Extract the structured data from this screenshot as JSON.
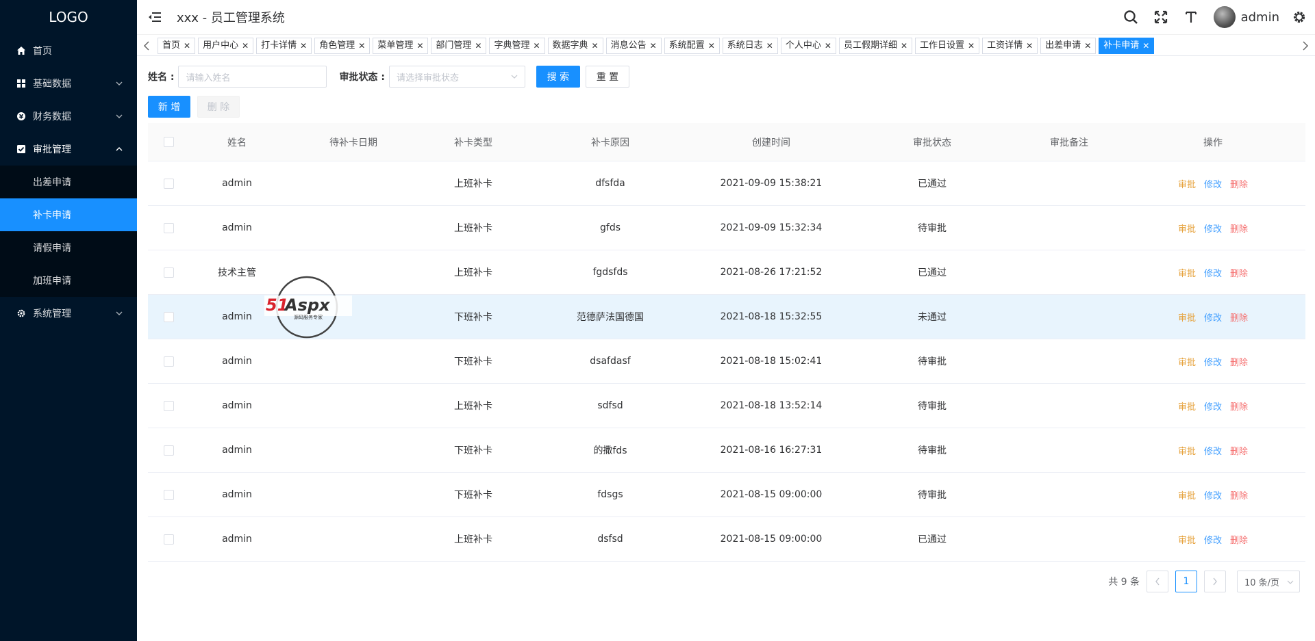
{
  "sidebar": {
    "logo": "LOGO",
    "items": [
      {
        "label": "首页",
        "icon": "home-icon"
      },
      {
        "label": "基础数据",
        "icon": "grid-icon"
      },
      {
        "label": "财务数据",
        "icon": "money-icon"
      },
      {
        "label": "审批管理",
        "icon": "check-square-icon"
      },
      {
        "label": "系统管理",
        "icon": "gear-icon"
      }
    ],
    "approval_sub": [
      "出差申请",
      "补卡申请",
      "请假申请",
      "加班申请"
    ]
  },
  "header": {
    "title": "xxx - 员工管理系统",
    "user": "admin"
  },
  "tags": [
    "首页",
    "用户中心",
    "打卡详情",
    "角色管理",
    "菜单管理",
    "部门管理",
    "字典管理",
    "数据字典",
    "消息公告",
    "系统配置",
    "系统日志",
    "个人中心",
    "员工假期详细",
    "工作日设置",
    "工资详情",
    "出差申请",
    "补卡申请"
  ],
  "search": {
    "name_label": "姓名 :",
    "name_placeholder": "请输入姓名",
    "status_label": "审批状态 :",
    "status_placeholder": "请选择审批状态",
    "search_btn": "搜 索",
    "reset_btn": "重 置",
    "add_btn": "新 增",
    "delete_btn": "删 除"
  },
  "table": {
    "headers": [
      "姓名",
      "待补卡日期",
      "补卡类型",
      "补卡原因",
      "创建时间",
      "审批状态",
      "审批备注",
      "操作"
    ],
    "op_labels": [
      "审批",
      "修改",
      "删除"
    ],
    "rows": [
      {
        "name": "admin",
        "date": "",
        "type": "上班补卡",
        "reason": "dfsfda",
        "created": "2021-09-09 15:38:21",
        "status": "已通过",
        "remark": ""
      },
      {
        "name": "admin",
        "date": "",
        "type": "上班补卡",
        "reason": "gfds",
        "created": "2021-09-09 15:32:34",
        "status": "待审批",
        "remark": ""
      },
      {
        "name": "技术主管",
        "date": "",
        "type": "上班补卡",
        "reason": "fgdsfds",
        "created": "2021-08-26 17:21:52",
        "status": "已通过",
        "remark": ""
      },
      {
        "name": "admin",
        "date": "",
        "type": "下班补卡",
        "reason": "范德萨法国德国",
        "created": "2021-08-18 15:32:55",
        "status": "未通过",
        "remark": ""
      },
      {
        "name": "admin",
        "date": "",
        "type": "下班补卡",
        "reason": "dsafdasf",
        "created": "2021-08-18 15:02:41",
        "status": "待审批",
        "remark": ""
      },
      {
        "name": "admin",
        "date": "",
        "type": "上班补卡",
        "reason": "sdfsd",
        "created": "2021-08-18 13:52:14",
        "status": "待审批",
        "remark": ""
      },
      {
        "name": "admin",
        "date": "",
        "type": "下班补卡",
        "reason": "的撒fds",
        "created": "2021-08-16 16:27:31",
        "status": "待审批",
        "remark": ""
      },
      {
        "name": "admin",
        "date": "",
        "type": "下班补卡",
        "reason": "fdsgs",
        "created": "2021-08-15 09:00:00",
        "status": "待审批",
        "remark": ""
      },
      {
        "name": "admin",
        "date": "",
        "type": "上班补卡",
        "reason": "dsfsd",
        "created": "2021-08-15 09:00:00",
        "status": "已通过",
        "remark": ""
      }
    ]
  },
  "pager": {
    "total": "共 9 条",
    "current": "1",
    "page_size": "10 条/页"
  },
  "watermark": {
    "text": "51Aspx",
    "sub": "源码服务专家"
  },
  "colors": {
    "sidebar": "#001529",
    "accent": "#1890ff",
    "audit": "#e6a23c",
    "edit": "#409eff",
    "delete": "#f56c6c"
  }
}
